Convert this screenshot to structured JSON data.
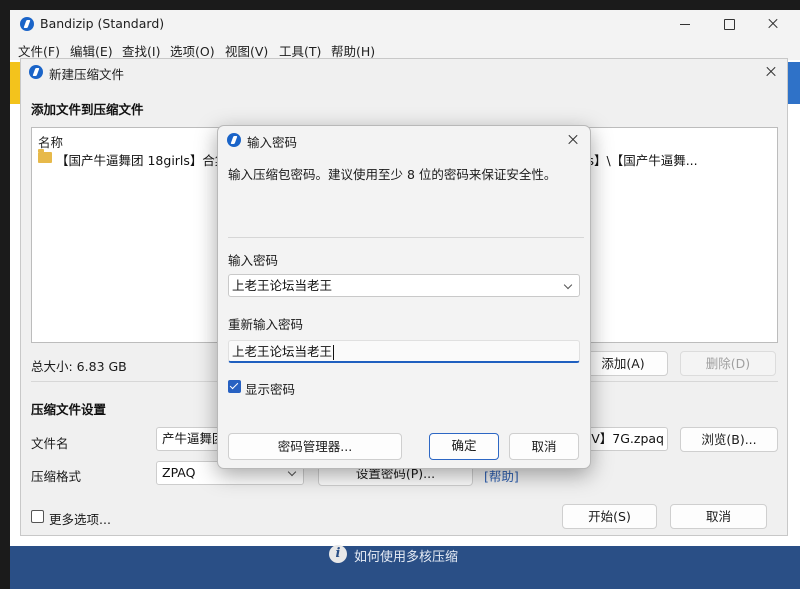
{
  "app": {
    "title": "Bandizip (Standard)",
    "menu": [
      "文件(F)",
      "编辑(E)",
      "查找(I)",
      "选项(O)",
      "视图(V)",
      "工具(T)",
      "帮助(H)"
    ],
    "footer_text": "如何使用多核压缩",
    "info_icon_glyph": "i"
  },
  "new_archive": {
    "window_title": "新建压缩文件",
    "section_add": "添加文件到压缩文件",
    "list": {
      "column_name": "名称",
      "item_left": "【国产牛逼舞团 18girls】合集",
      "item_right": "ls】\\【国产牛逼舞..."
    },
    "total_size": "总大小: 6.83 GB",
    "add_button": "添加(A)",
    "delete_button": "删除(D)",
    "section_settings": "压缩文件设置",
    "filename_label": "文件名",
    "filename_left": "产牛逼舞团",
    "filename_right": "SV】7G.zpaq",
    "browse_button": "浏览(B)...",
    "format_label": "压缩格式",
    "format_value": "ZPAQ",
    "set_password_button": "设置密码(P)...",
    "help_link": "[帮助]",
    "more_options": "更多选项...",
    "start_button": "开始(S)",
    "cancel_button": "取消"
  },
  "password_dialog": {
    "title": "输入密码",
    "description": "输入压缩包密码。建议使用至少 8 位的密码来保证安全性。",
    "password_label": "输入密码",
    "password_value": "上老王论坛当老王",
    "reenter_label": "重新输入密码",
    "reenter_value": "上老王论坛当老王",
    "show_password_label": "显示密码",
    "show_password_checked": true,
    "manager_button": "密码管理器...",
    "ok_button": "确定",
    "cancel_button": "取消",
    "accent_color": "#2761c2"
  }
}
